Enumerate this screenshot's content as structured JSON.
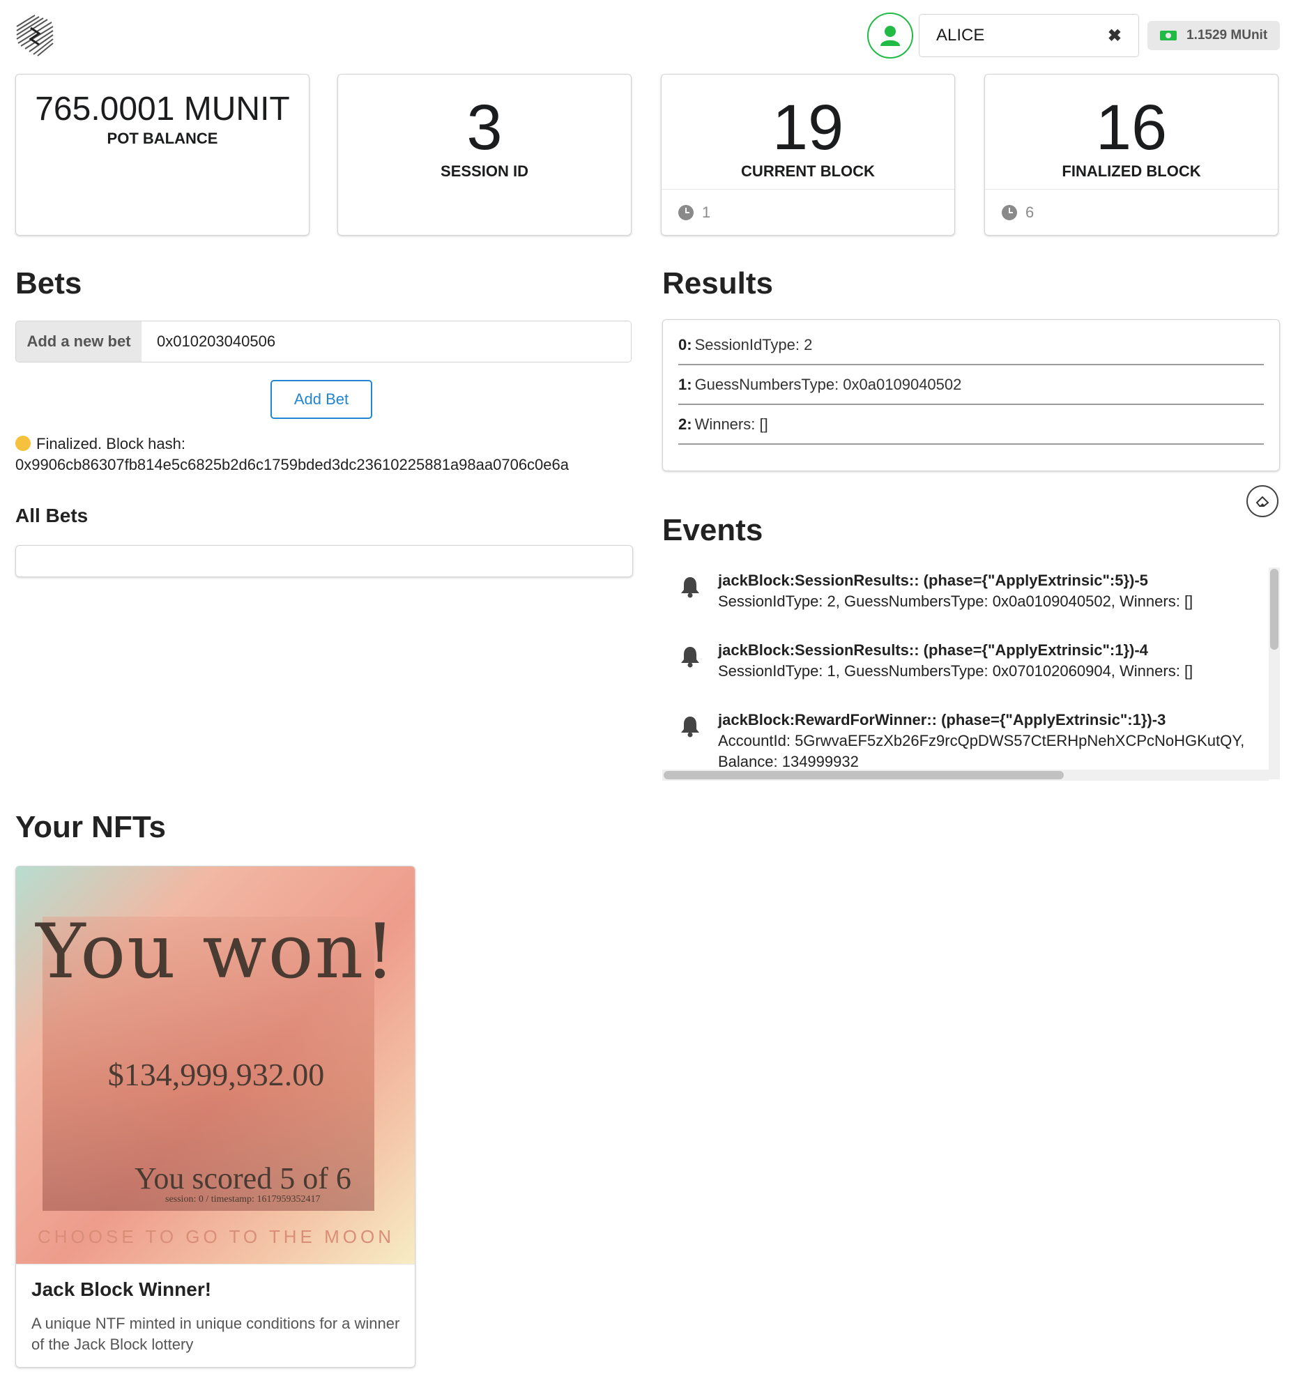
{
  "header": {
    "account_name": "ALICE",
    "clear_glyph": "✖",
    "balance": "1.1529 MUnit",
    "icons": {
      "logo": "substrate-logo-icon",
      "avatar": "user-icon",
      "balance": "money-bill-icon"
    }
  },
  "stats": {
    "pot": {
      "value": "765.0001 MUNIT",
      "label": "POT BALANCE"
    },
    "session": {
      "value": "3",
      "label": "SESSION ID"
    },
    "current_block": {
      "value": "19",
      "label": "CURRENT BLOCK",
      "extra": "1"
    },
    "finalized_block": {
      "value": "16",
      "label": "FINALIZED BLOCK",
      "extra": "6"
    }
  },
  "bets": {
    "title": "Bets",
    "input_label": "Add a new bet",
    "input_value": "0x010203040506",
    "button_label": "Add Bet",
    "status_prefix": "Finalized. Block hash:",
    "status_hash": "0x9906cb86307fb814e5c6825b2d6c1759bded3dc23610225881a98aa0706c0e6a",
    "all_bets_title": "All Bets"
  },
  "results": {
    "title": "Results",
    "rows": [
      {
        "index": "0:",
        "text": "SessionIdType: 2"
      },
      {
        "index": "1:",
        "text": "GuessNumbersType: 0x0a0109040502"
      },
      {
        "index": "2:",
        "text": "Winners: []"
      }
    ]
  },
  "events": {
    "title": "Events",
    "items": [
      {
        "header": "jackBlock:SessionResults:: (phase={\"ApplyExtrinsic\":5})-5",
        "line1": "SessionIdType: 2, GuessNumbersType: 0x0a0109040502, Winners: []",
        "line2": ""
      },
      {
        "header": "jackBlock:SessionResults:: (phase={\"ApplyExtrinsic\":1})-4",
        "line1": "SessionIdType: 1, GuessNumbersType: 0x070102060904, Winners: []",
        "line2": ""
      },
      {
        "header": "jackBlock:RewardForWinner:: (phase={\"ApplyExtrinsic\":1})-3",
        "line1": "AccountId: 5GrwvaEF5zXb26Fz9rcQpDWS57CtERHpNehXCPcNoHGKutQY,",
        "line2": "Balance: 134999932"
      }
    ]
  },
  "nfts": {
    "title": "Your NFTs",
    "card": {
      "image_headline": "You won!",
      "image_amount": "$134,999,932.00",
      "image_score": "You scored 5 of 6",
      "image_meta": "session: 0 / timestamp: 1617959352417",
      "image_tagline": "CHOOSE TO GO TO THE MOON",
      "name": "Jack Block Winner!",
      "description": "A unique NTF minted in unique conditions for a winner of the Jack Block lottery"
    }
  },
  "colors": {
    "accent_blue": "#2185d0",
    "accent_green": "#21ba45"
  }
}
